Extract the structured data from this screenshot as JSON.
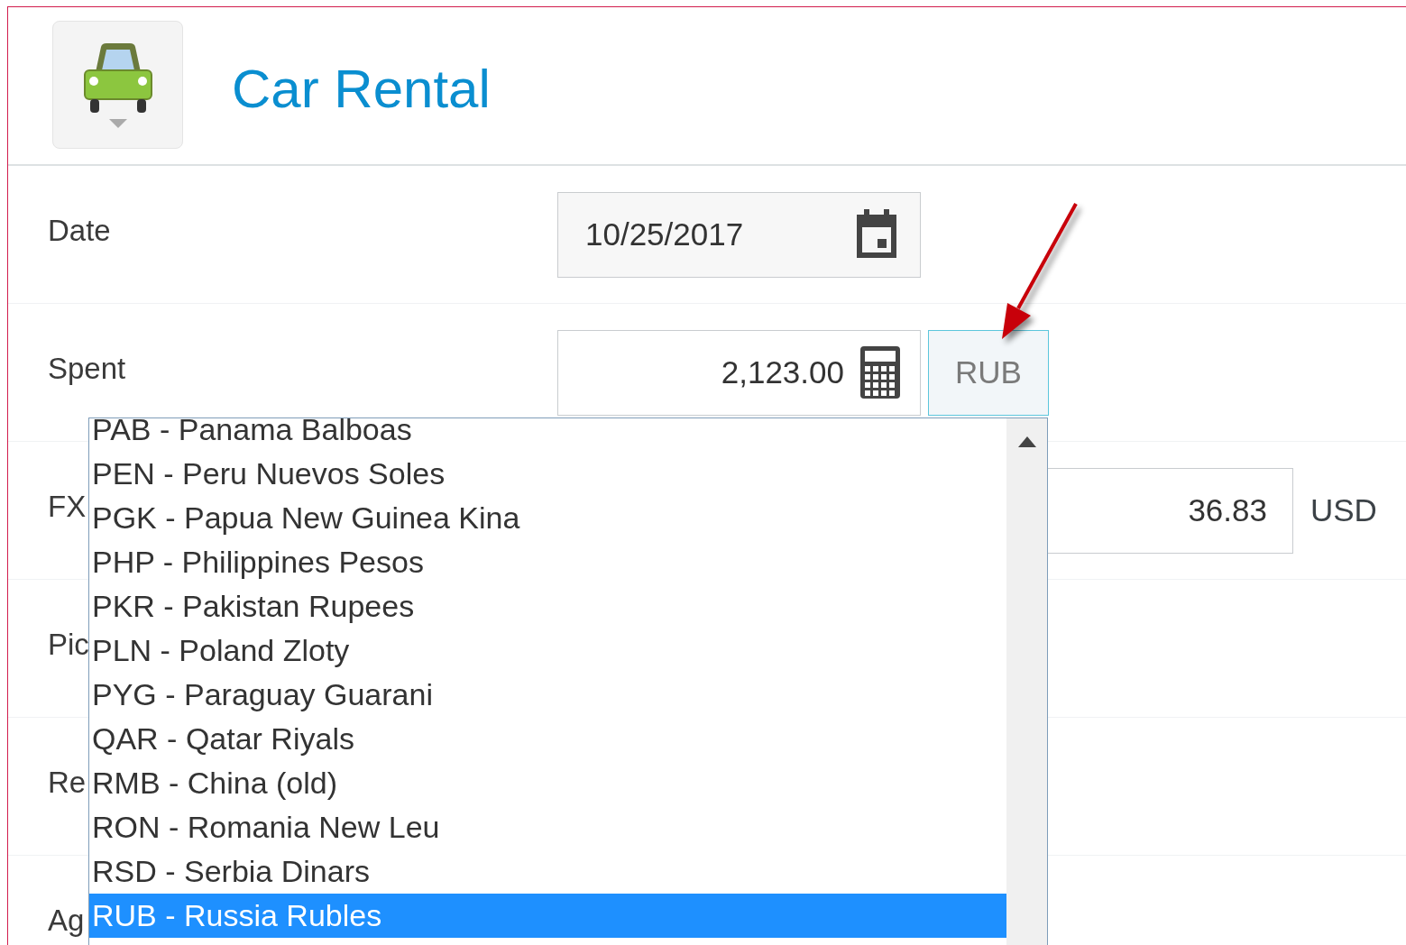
{
  "header": {
    "title": "Car Rental"
  },
  "fields": [
    {
      "label": "Date",
      "kind": "date",
      "value": "10/25/2017"
    },
    {
      "label": "Spent",
      "kind": "amount",
      "value": "2,123.00",
      "currency": "RUB"
    },
    {
      "label": "FX",
      "kind": "converted",
      "value": "36.83",
      "currency": "USD"
    },
    {
      "label": "Pic",
      "kind": "text"
    },
    {
      "label": "Re",
      "kind": "text"
    },
    {
      "label": "Ag",
      "kind": "text"
    }
  ],
  "currency_dropdown": {
    "options": [
      {
        "label": "PAB - Panama Balboas",
        "selected": false
      },
      {
        "label": "PEN - Peru Nuevos Soles",
        "selected": false
      },
      {
        "label": "PGK - Papua New Guinea Kina",
        "selected": false
      },
      {
        "label": "PHP - Philippines Pesos",
        "selected": false
      },
      {
        "label": "PKR - Pakistan Rupees",
        "selected": false
      },
      {
        "label": "PLN - Poland Zloty",
        "selected": false
      },
      {
        "label": "PYG - Paraguay Guarani",
        "selected": false
      },
      {
        "label": "QAR - Qatar Riyals",
        "selected": false
      },
      {
        "label": "RMB - China (old)",
        "selected": false
      },
      {
        "label": "RON - Romania New Leu",
        "selected": false
      },
      {
        "label": "RSD - Serbia Dinars",
        "selected": false
      },
      {
        "label": "RUB - Russia Rubles",
        "selected": true
      }
    ]
  }
}
